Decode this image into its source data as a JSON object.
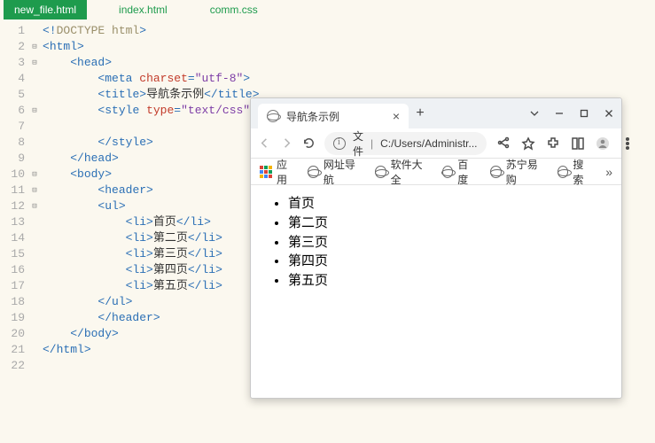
{
  "tabs": [
    {
      "label": "new_file.html",
      "active": true
    },
    {
      "label": "index.html",
      "active": false
    },
    {
      "label": "comm.css",
      "active": false
    }
  ],
  "code_lines": {
    "l1": "<!DOCTYPE html>",
    "l2": "<html>",
    "l3": "    <head>",
    "l4": "        <meta charset=\"utf-8\">",
    "l5": "        <title>导航条示例</title>",
    "l6": "        <style type=\"text/css\">",
    "l7": "",
    "l8": "        </style>",
    "l9": "    </head>",
    "l10": "    <body>",
    "l11": "        <header>",
    "l12": "        <ul>",
    "l13": "            <li>首页</li>",
    "l14": "            <li>第二页</li>",
    "l15": "            <li>第三页</li>",
    "l16": "            <li>第四页</li>",
    "l17": "            <li>第五页</li>",
    "l18": "        </ul>",
    "l19": "        </header>",
    "l20": "    </body>",
    "l21": "</html>",
    "l22": ""
  },
  "browser": {
    "tab_title": "导航条示例",
    "address_prefix": "文件",
    "address_path": "C:/Users/Administr...",
    "bookmarks": {
      "apps": "应用",
      "b1": "网址导航",
      "b2": "软件大全",
      "b3": "百度",
      "b4": "苏宁易购",
      "b5": "搜索"
    },
    "page_items": [
      "首页",
      "第二页",
      "第三页",
      "第四页",
      "第五页"
    ]
  }
}
